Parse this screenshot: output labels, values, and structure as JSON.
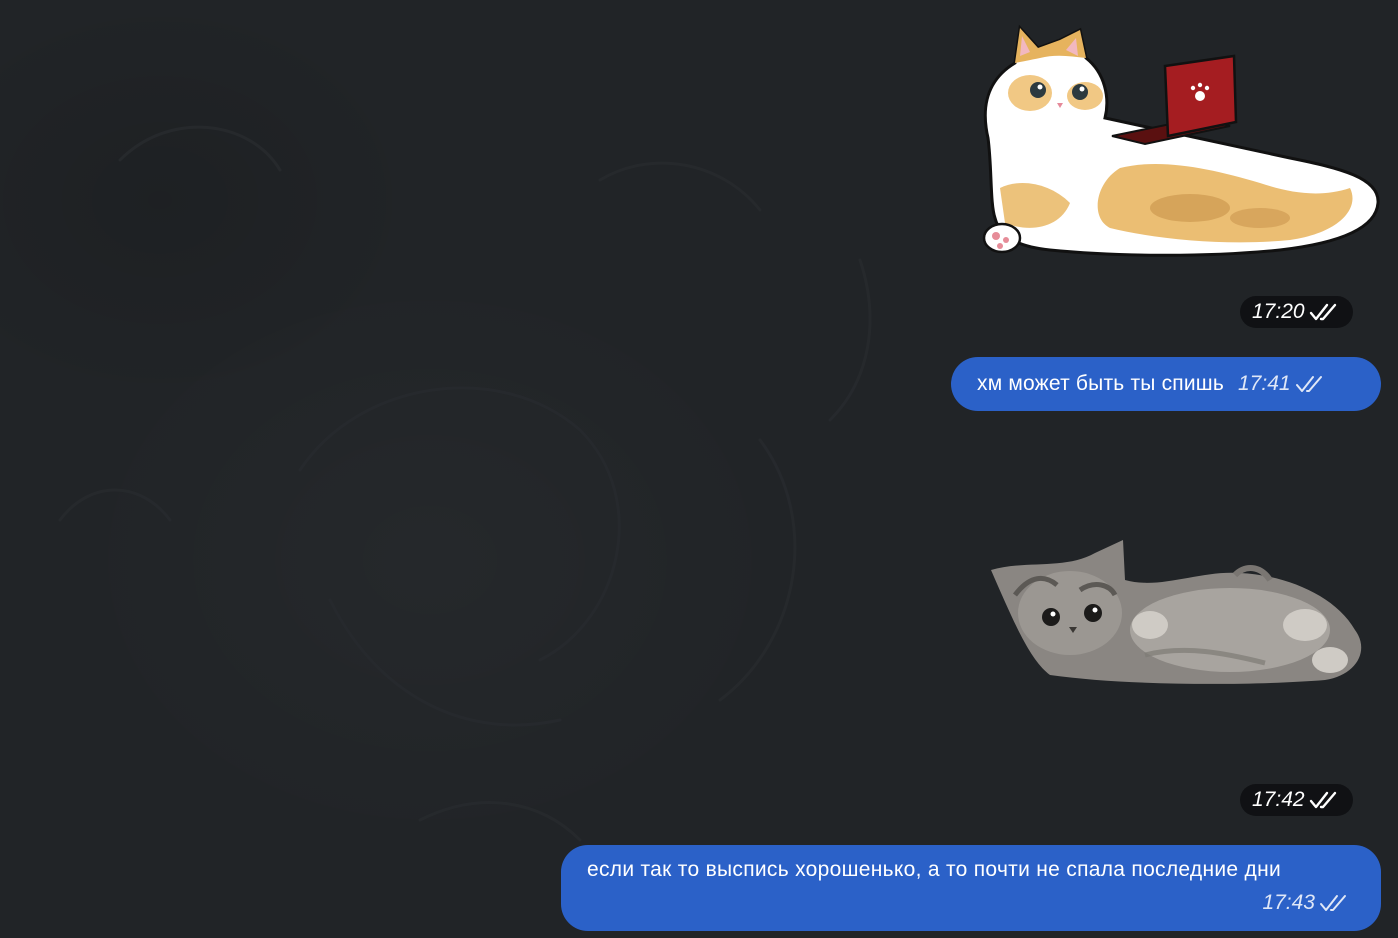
{
  "colors": {
    "background": "#212427",
    "outgoing_bubble": "#2b61c8",
    "text": "#ffffff",
    "time_pill": "#0c0e10"
  },
  "messages": [
    {
      "type": "sticker",
      "sticker_icon": "cat-with-laptop-sticker",
      "time": "17:20",
      "status_icon": "double-check-icon"
    },
    {
      "type": "text",
      "text": "хм может быть ты спишь",
      "time": "17:41",
      "status_icon": "double-check-icon"
    },
    {
      "type": "sticker",
      "sticker_icon": "lying-kitten-sticker",
      "time": "17:42",
      "status_icon": "double-check-icon"
    },
    {
      "type": "text",
      "text": "если так то выспись хорошенько, а то почти не спала последние дни",
      "time": "17:43",
      "status_icon": "double-check-icon"
    }
  ]
}
